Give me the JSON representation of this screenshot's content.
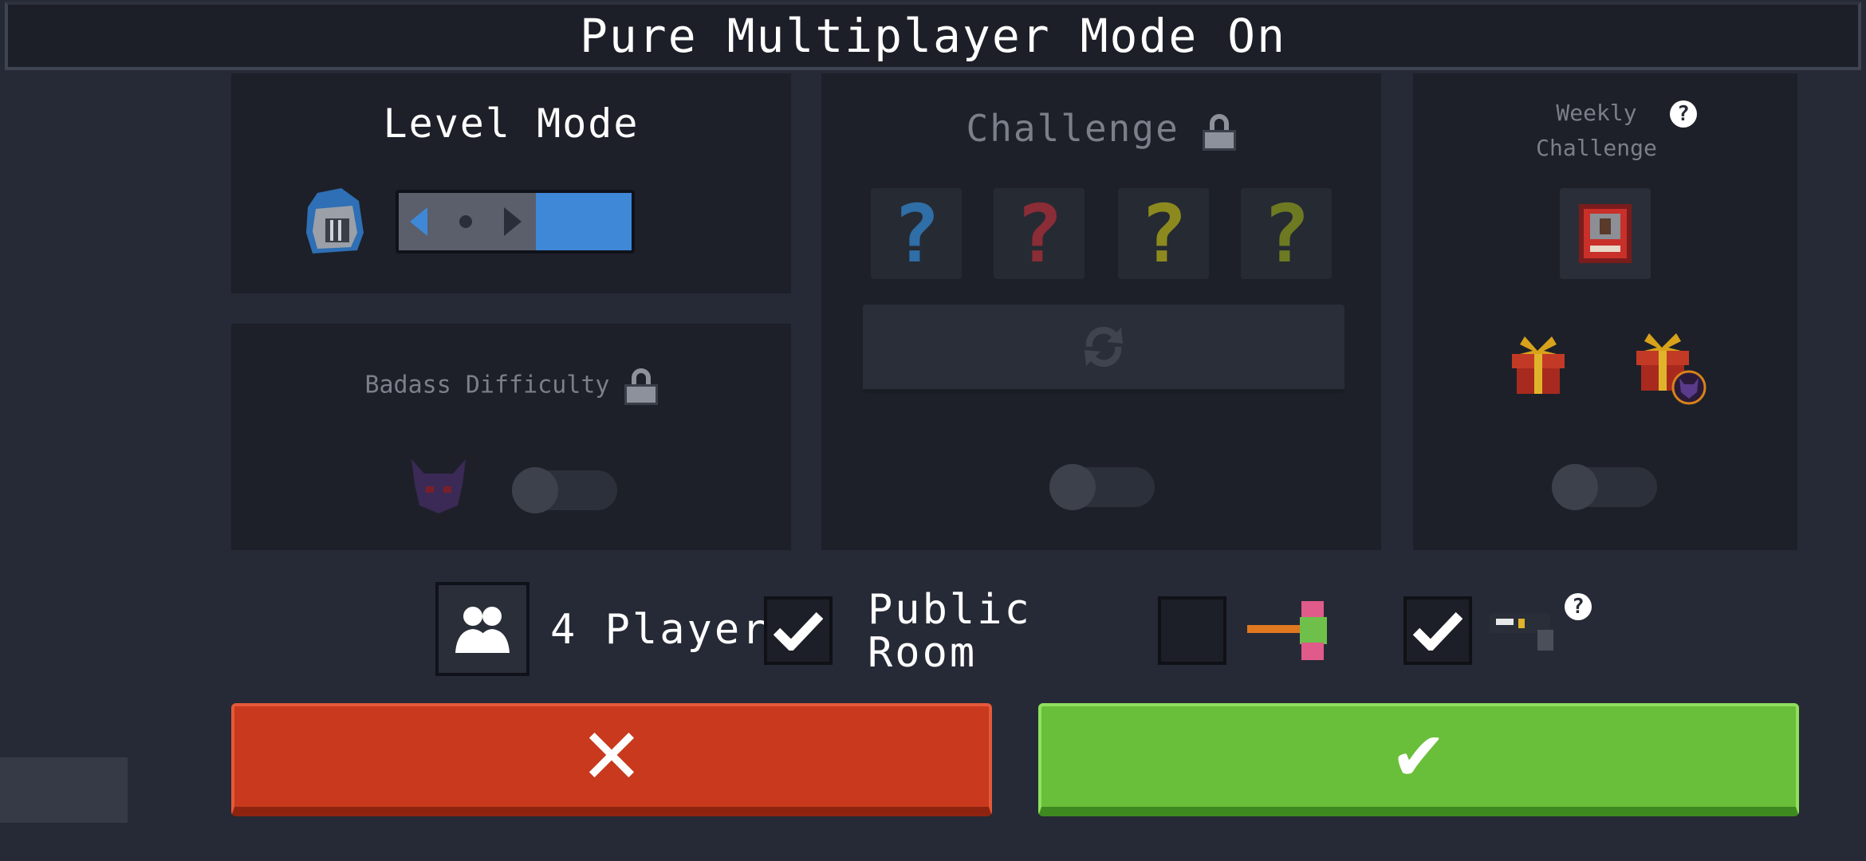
{
  "header": {
    "title": "Pure Multiplayer Mode On"
  },
  "level_mode": {
    "title": "Level Mode",
    "slider_state": "blue-selected"
  },
  "badass": {
    "title": "Badass Difficulty",
    "locked": true,
    "toggle_on": false
  },
  "challenge": {
    "title": "Challenge",
    "locked": true,
    "slots": [
      {
        "glyph": "?",
        "color": "#2f6ea6"
      },
      {
        "glyph": "?",
        "color": "#8a2d36"
      },
      {
        "glyph": "?",
        "color": "#8c8a1e"
      },
      {
        "glyph": "?",
        "color": "#6e7a22"
      }
    ],
    "refresh_icon": "refresh-icon",
    "toggle_on": false
  },
  "weekly": {
    "title_line1": "Weekly",
    "title_line2": "Challenge",
    "help_glyph": "?",
    "toggle_on": false
  },
  "options": {
    "players_label": "4 Players",
    "public_room_line1": "Public",
    "public_room_line2": "Room",
    "public_checked": true,
    "hammer_checked": false,
    "gun_checked": true,
    "gun_help_glyph": "?"
  },
  "buttons": {
    "cancel_glyph": "✕",
    "confirm_glyph": "✔"
  },
  "colors": {
    "cancel": "#c8391d",
    "confirm": "#6abf3a",
    "accent_blue": "#3f88d8"
  }
}
